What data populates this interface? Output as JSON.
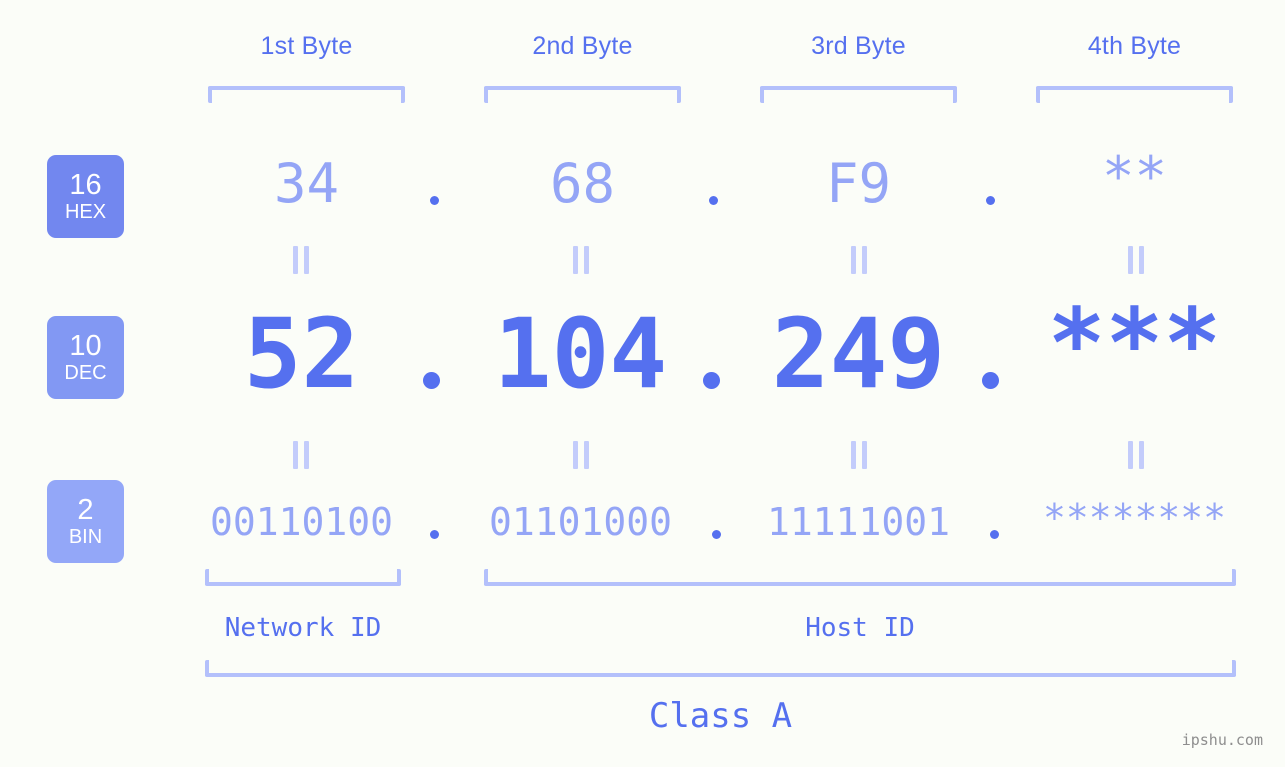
{
  "meta": {
    "background": "#fbfdf8",
    "accent": "#5570ef",
    "accent_light": "#94a5f6",
    "bracket": "#b3c0fb",
    "watermark": "ipshu.com"
  },
  "headers": [
    {
      "label": "1st Byte"
    },
    {
      "label": "2nd Byte"
    },
    {
      "label": "3rd Byte"
    },
    {
      "label": "4th Byte"
    }
  ],
  "bases": [
    {
      "number": "16",
      "name": "HEX",
      "color": "#7287ef"
    },
    {
      "number": "10",
      "name": "DEC",
      "color": "#8298f3"
    },
    {
      "number": "2",
      "name": "BIN",
      "color": "#93a7f8"
    }
  ],
  "rows": {
    "hex": {
      "values": [
        "34",
        "68",
        "F9",
        "**"
      ],
      "separator": "."
    },
    "dec": {
      "values": [
        "52",
        "104",
        "249",
        "***"
      ],
      "separator": "."
    },
    "bin": {
      "values": [
        "00110100",
        "01101000",
        "11111001",
        "********"
      ],
      "separator": "."
    }
  },
  "equals_marks": {
    "symbol": "||",
    "count_per_row": 4,
    "rows": 2
  },
  "segments": [
    {
      "label": "Network ID"
    },
    {
      "label": "Host ID"
    }
  ],
  "class": {
    "label": "Class A"
  }
}
